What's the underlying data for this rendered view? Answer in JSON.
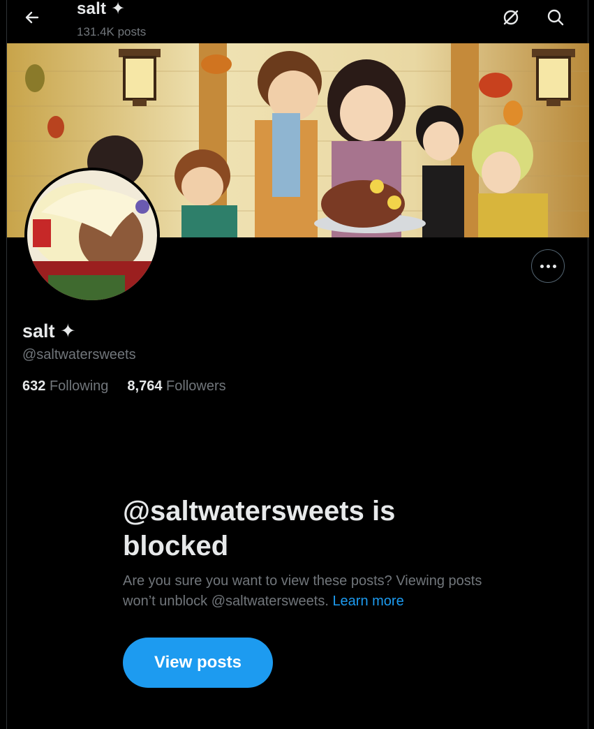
{
  "header": {
    "title": "salt ✦",
    "posts_count": "131.4K posts",
    "back_icon": "arrow-left-icon",
    "premium_icon": "circle-slash-icon",
    "search_icon": "search-icon"
  },
  "profile": {
    "name": "salt ✦",
    "handle": "@saltwatersweets",
    "following_count": "632",
    "following_label": "Following",
    "followers_count": "8,764",
    "followers_label": "Followers"
  },
  "blocked": {
    "title": "@saltwatersweets is blocked",
    "body": "Are you sure you want to view these posts? Viewing posts won’t unblock @saltwatersweets.",
    "learn_more": "Learn more",
    "button_label": "View posts"
  },
  "colors": {
    "accent": "#1d9bf0",
    "background": "#000000",
    "muted_text": "#71767b",
    "primary_text": "#e7e9ea"
  }
}
